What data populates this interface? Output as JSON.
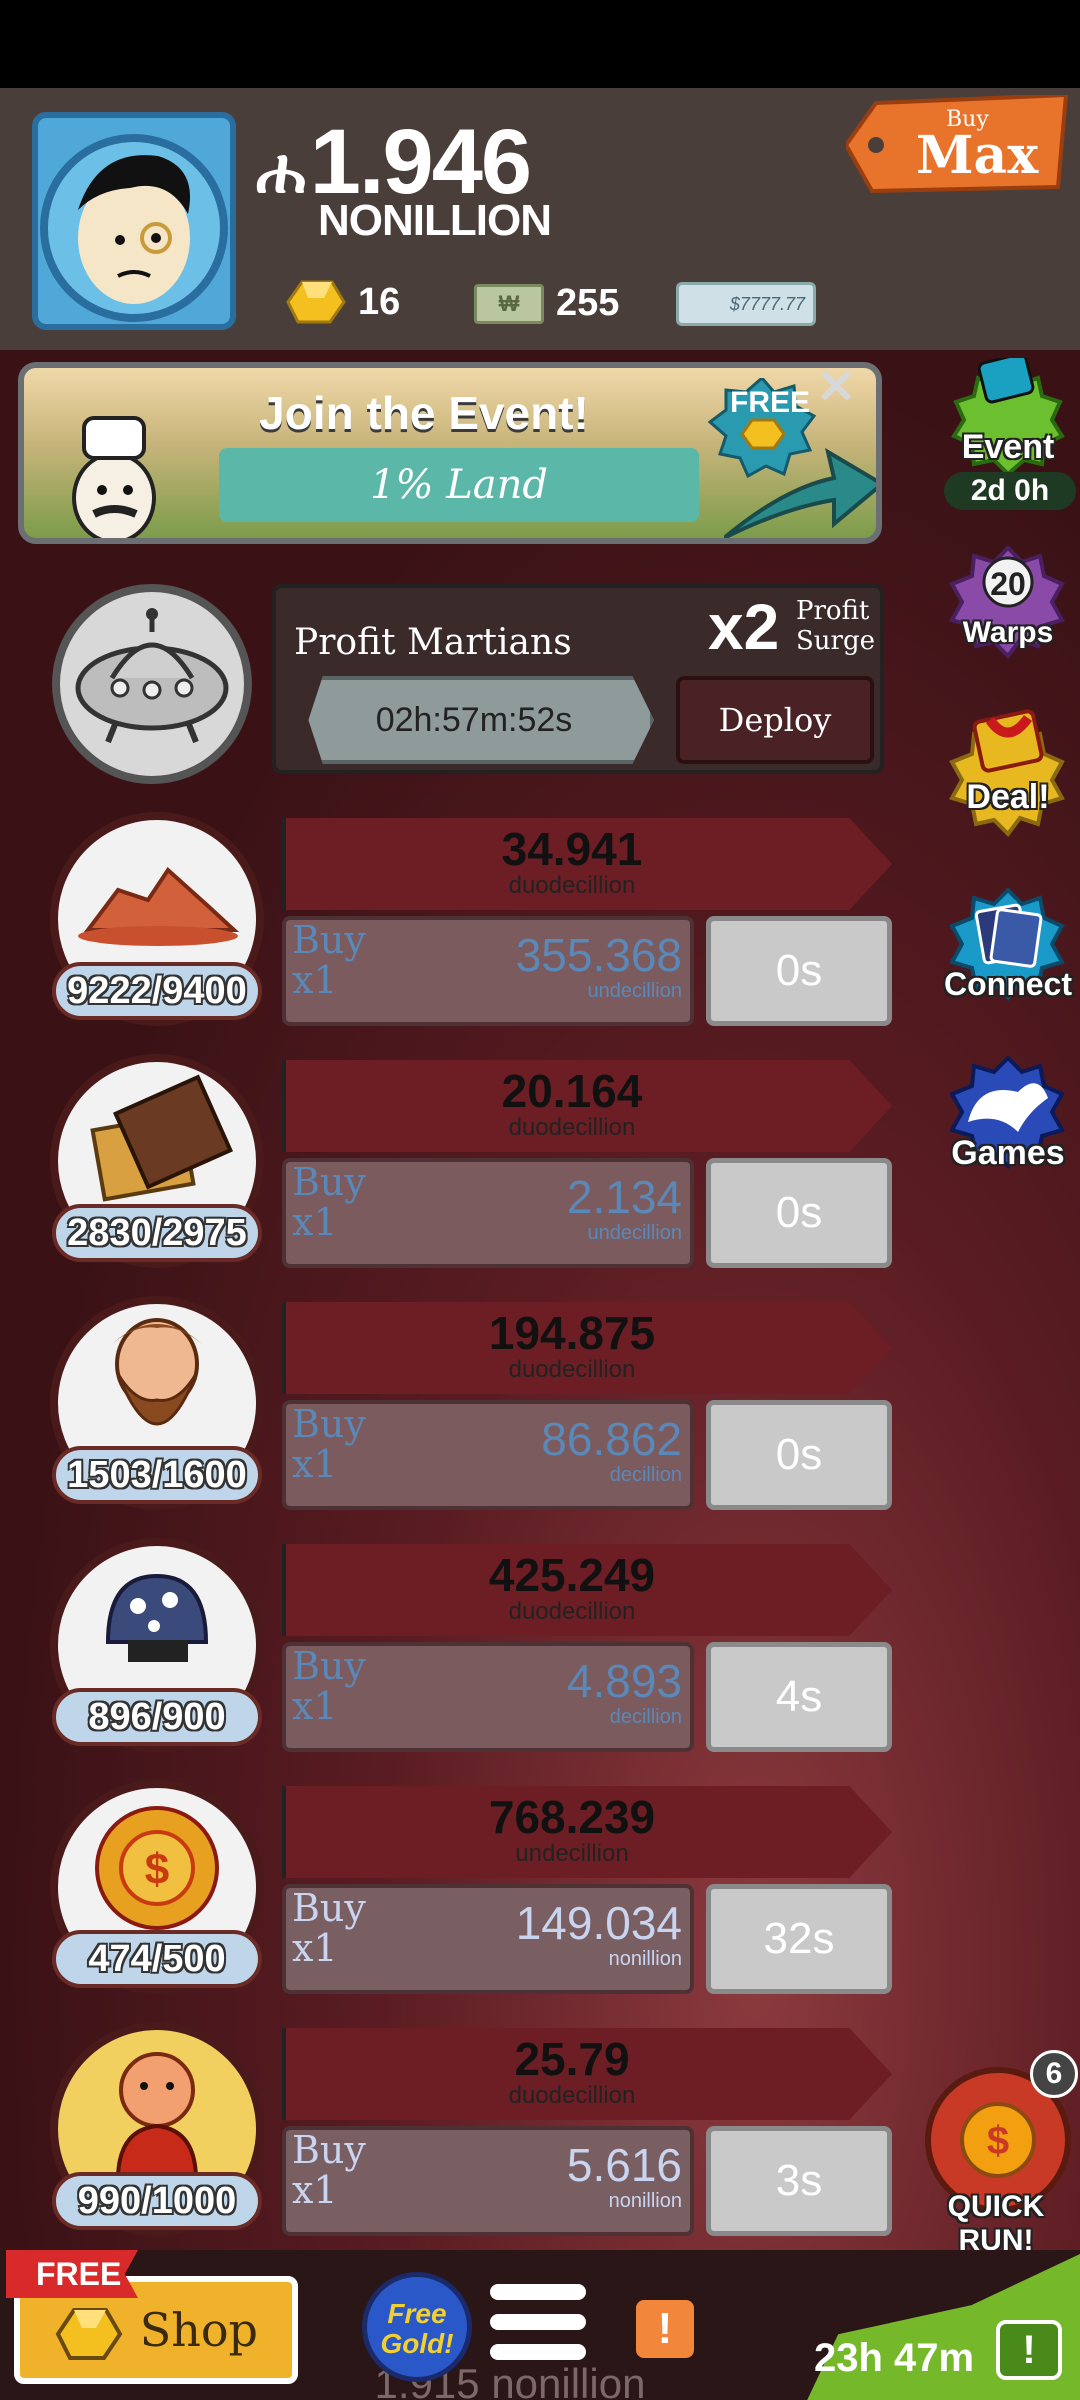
{
  "header": {
    "cash_symbol": "ሐ",
    "cash_value": "1.946",
    "cash_unit": "NONILLION",
    "gold": "16",
    "megabucks": "255",
    "bill_label": "$7777.77",
    "buy_max_top": "Buy",
    "buy_max_main": "Max"
  },
  "event_banner": {
    "title": "Join the Event!",
    "subtitle": "1% Land",
    "free_label": "FREE",
    "close": "✕"
  },
  "side": {
    "event_label": "Event",
    "event_timer": "2d 0h",
    "warps_count": "20",
    "warps_label": "Warps",
    "deal_label": "Deal!",
    "connect_label": "Connect",
    "games_label": "Games"
  },
  "manager": {
    "name": "Profit Martians",
    "multiplier": "x2",
    "surge_line1": "Profit",
    "surge_line2": "Surge",
    "timer": "02h:57m:52s",
    "deploy": "Deploy"
  },
  "businesses": [
    {
      "count": "9222/9400",
      "profit": "34.941",
      "profit_unit": "duodecillion",
      "buy": "Buy",
      "mult": "x1",
      "cost": "355.368",
      "cost_unit": "undecillion",
      "time": "0s",
      "icon": "rocks-icon"
    },
    {
      "count": "2830/2975",
      "profit": "20.164",
      "profit_unit": "duodecillion",
      "buy": "Buy",
      "mult": "x1",
      "cost": "2.134",
      "cost_unit": "undecillion",
      "time": "0s",
      "icon": "chocolate-icon"
    },
    {
      "count": "1503/1600",
      "profit": "194.875",
      "profit_unit": "duodecillion",
      "buy": "Buy",
      "mult": "x1",
      "cost": "86.862",
      "cost_unit": "decillion",
      "time": "0s",
      "icon": "bearded-man-icon"
    },
    {
      "count": "896/900",
      "profit": "425.249",
      "profit_unit": "duodecillion",
      "buy": "Buy",
      "mult": "x1",
      "cost": "4.893",
      "cost_unit": "decillion",
      "time": "4s",
      "icon": "mushroom-icon"
    },
    {
      "count": "474/500",
      "profit": "768.239",
      "profit_unit": "undecillion",
      "buy": "Buy",
      "mult": "x1",
      "cost": "149.034",
      "cost_unit": "nonillion",
      "time": "32s",
      "icon": "sun-coin-icon"
    },
    {
      "count": "990/1000",
      "profit": "25.79",
      "profit_unit": "duodecillion",
      "buy": "Buy",
      "mult": "x1",
      "cost": "5.616",
      "cost_unit": "nonillion",
      "time": "3s",
      "icon": "martian-icon"
    }
  ],
  "quick_run": {
    "count": "6",
    "label": "QUICK RUN!"
  },
  "bottom": {
    "free_ribbon": "FREE",
    "shop": "Shop",
    "free_gold_line1": "Free",
    "free_gold_line2": "Gold!",
    "alert": "!",
    "below_text": "1.915 nonillion",
    "timer": "23h 47m",
    "tv_alert": "!"
  }
}
